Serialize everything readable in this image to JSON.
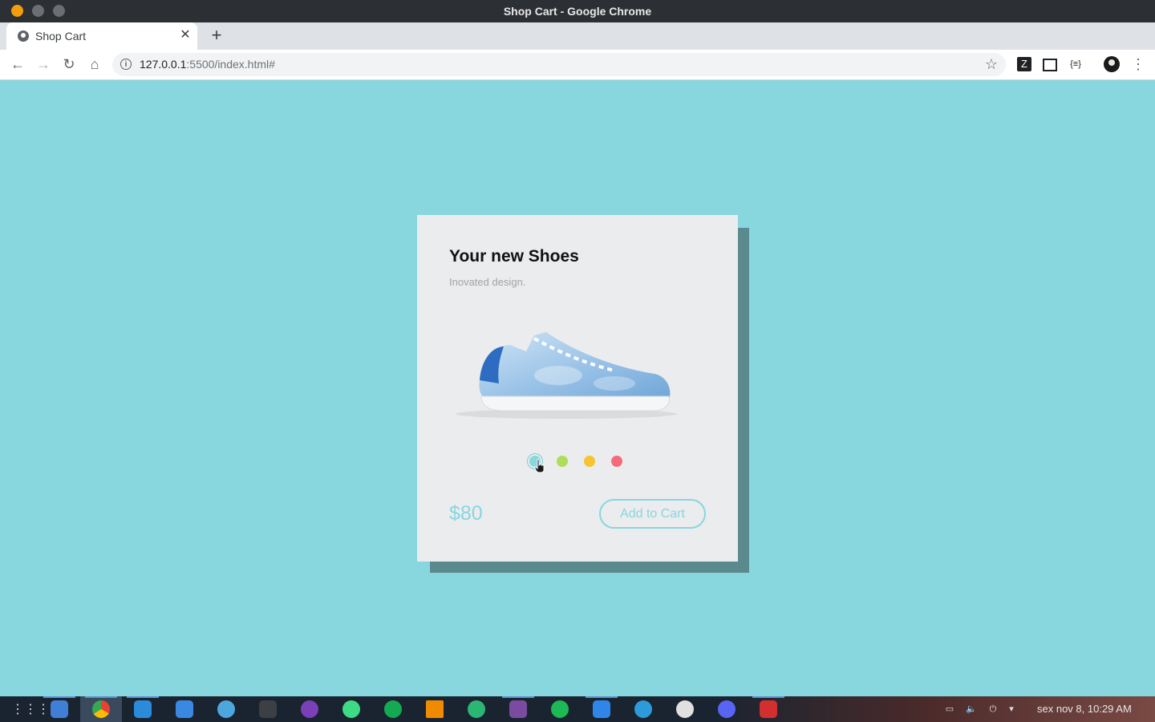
{
  "window": {
    "title": "Shop Cart - Google Chrome"
  },
  "browser": {
    "tab_title": "Shop Cart",
    "url_host": "127.0.0.1",
    "url_rest": ":5500/index.html#"
  },
  "card": {
    "title": "Your new Shoes",
    "subtitle": "Inovated design.",
    "price": "$80",
    "button_label": "Add to Cart",
    "colors": [
      {
        "name": "teal",
        "hex": "#88d6de",
        "selected": true
      },
      {
        "name": "green",
        "hex": "#aedd5a",
        "selected": false
      },
      {
        "name": "yellow",
        "hex": "#f5c42f",
        "selected": false
      },
      {
        "name": "red",
        "hex": "#f56b7a",
        "selected": false
      }
    ]
  },
  "taskbar": {
    "clock": "sex nov  8, 10:29 AM",
    "apps": [
      "apps-grid-icon",
      "files-icon",
      "chrome-icon",
      "vscode-icon",
      "brackets-icon",
      "flathub-icon",
      "terminal-icon",
      "screen-recorder-icon",
      "android-studio-icon",
      "mongodb-compass-icon",
      "vlc-icon",
      "cloud-icon",
      "video-editor-icon",
      "spotify-icon",
      "software-center-icon",
      "downloader-icon",
      "inkscape-icon",
      "discord-icon",
      "pdf-reader-icon"
    ]
  },
  "theme": {
    "accent": "#88d6de",
    "shadow": "#5b8a8e",
    "card_bg": "#ebecee"
  }
}
